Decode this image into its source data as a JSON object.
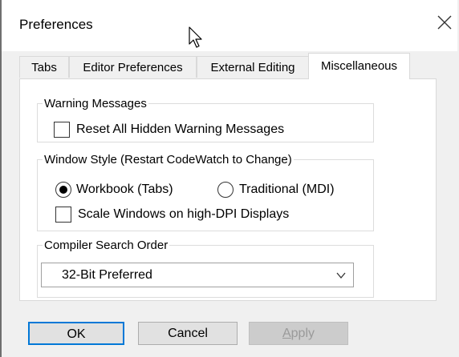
{
  "window": {
    "title": "Preferences",
    "close_icon": "close-icon"
  },
  "tabs": [
    {
      "label": "Tabs",
      "active": false
    },
    {
      "label": "Editor Preferences",
      "active": false
    },
    {
      "label": "External Editing",
      "active": false
    },
    {
      "label": "Miscellaneous",
      "active": true
    }
  ],
  "warning": {
    "legend": "Warning Messages",
    "reset_label": "Reset All Hidden Warning Messages",
    "reset_checked": false
  },
  "window_style": {
    "legend": "Window Style (Restart CodeWatch to Change)",
    "options": [
      {
        "label": "Workbook (Tabs)",
        "selected": true
      },
      {
        "label": "Traditional (MDI)",
        "selected": false
      }
    ],
    "scale_label": "Scale Windows on high-DPI Displays",
    "scale_checked": false
  },
  "compiler": {
    "legend": "Compiler Search Order",
    "selected": "32-Bit Preferred"
  },
  "buttons": {
    "ok": "OK",
    "cancel": "Cancel",
    "apply_a": "A",
    "apply_rest": "pply"
  },
  "colors": {
    "focus_border": "#0078d7",
    "button_face": "#e1e1e1",
    "disabled_text": "#9a9a9a"
  }
}
